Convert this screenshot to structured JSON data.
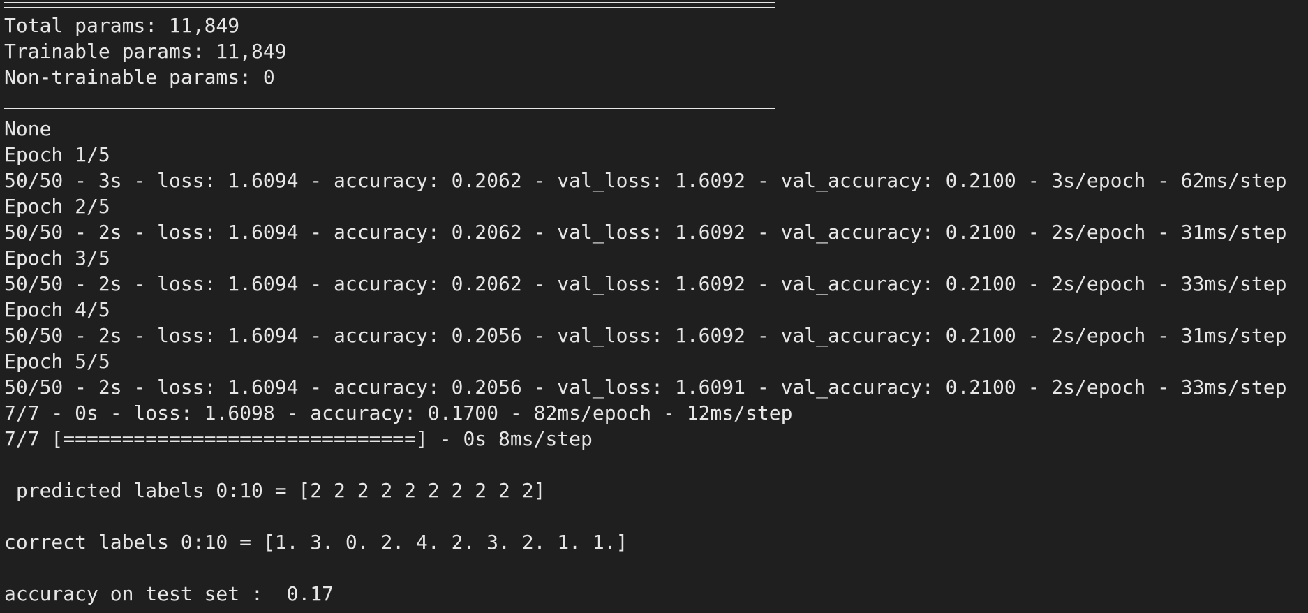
{
  "terminal": {
    "summary": {
      "total_params": "Total params: 11,849",
      "trainable_params": "Trainable params: 11,849",
      "non_trainable_params": "Non-trainable params: 0"
    },
    "none_line": "None",
    "epochs": [
      {
        "header": "Epoch 1/5",
        "log": "50/50 - 3s - loss: 1.6094 - accuracy: 0.2062 - val_loss: 1.6092 - val_accuracy: 0.2100 - 3s/epoch - 62ms/step"
      },
      {
        "header": "Epoch 2/5",
        "log": "50/50 - 2s - loss: 1.6094 - accuracy: 0.2062 - val_loss: 1.6092 - val_accuracy: 0.2100 - 2s/epoch - 31ms/step"
      },
      {
        "header": "Epoch 3/5",
        "log": "50/50 - 2s - loss: 1.6094 - accuracy: 0.2062 - val_loss: 1.6092 - val_accuracy: 0.2100 - 2s/epoch - 33ms/step"
      },
      {
        "header": "Epoch 4/5",
        "log": "50/50 - 2s - loss: 1.6094 - accuracy: 0.2056 - val_loss: 1.6092 - val_accuracy: 0.2100 - 2s/epoch - 31ms/step"
      },
      {
        "header": "Epoch 5/5",
        "log": "50/50 - 2s - loss: 1.6094 - accuracy: 0.2056 - val_loss: 1.6091 - val_accuracy: 0.2100 - 2s/epoch - 33ms/step"
      }
    ],
    "evaluate_line": "7/7 - 0s - loss: 1.6098 - accuracy: 0.1700 - 82ms/epoch - 12ms/step",
    "predict_line": "7/7 [==============================] - 0s 8ms/step",
    "predicted_labels": " predicted labels 0:10 = [2 2 2 2 2 2 2 2 2 2]",
    "correct_labels": "correct labels 0:10 = [1. 3. 0. 2. 4. 2. 3. 2. 1. 1.]",
    "test_accuracy": "accuracy on test set :  0.17"
  },
  "colors": {
    "background": "#1f1f1f",
    "text": "#e6e6e6"
  }
}
